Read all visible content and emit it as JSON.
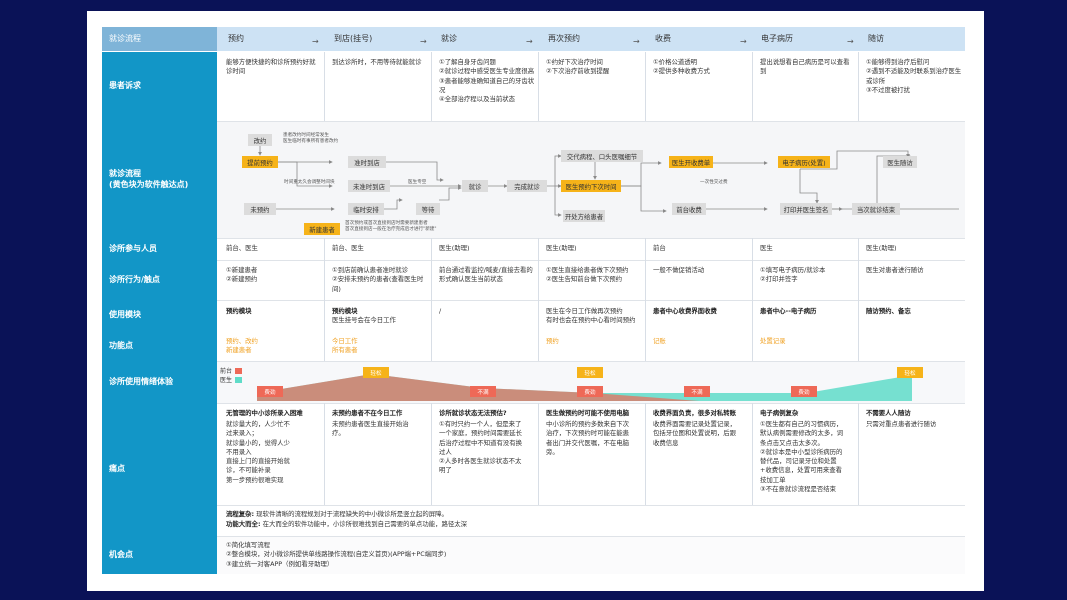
{
  "row_labels": {
    "header": "就诊流程",
    "appeal": "患者诉求",
    "flow": "就诊流程\n(黄色块为软件触达点)",
    "staff": "诊所参与人员",
    "behavior": "诊所行为/触点",
    "module": "使用模块",
    "function": "功能点",
    "emotion": "诊所使用情绪体验",
    "pain": "痛点",
    "opportunity": "机会点"
  },
  "stages": [
    "预约",
    "到店(挂号)",
    "就诊",
    "再次预约",
    "收费",
    "电子病历",
    "随访"
  ],
  "appeals": [
    "能够方便快捷的和诊所预约好就诊时间",
    "到达诊所时，不用等待就能就诊",
    "①了解自身牙齿问题\n②就诊过程中感受医生专业度很高\n③患者能够准确知道自己的牙齿状况\n④全部治疗程以及当前状态",
    "①约好下次治疗时间\n②下次治疗前收到提醒",
    "①价格公道透明\n②提供多种收费方式",
    "提出说想看自己病历是可以查看到",
    "①能够得到治疗后慰问\n②遇到不适能及时联系到治疗医生或诊所\n③不过度被打扰"
  ],
  "flow": {
    "nodes": {
      "reschedule": "改约",
      "book_ahead": "提前预约",
      "on_time": "准时到店",
      "not_on_time": "未准时到店",
      "not_booked": "未预约",
      "temp_arrange": "临时安排",
      "wait": "等待",
      "consult": "就诊",
      "done": "完成就诊",
      "handover": "交代病程、口头医嘱细节",
      "next_time": "医生预约下次时间",
      "prescribe": "开处方给患者",
      "bill": "医生开收费单",
      "front_charge": "前台收费",
      "emr": "电子病历(处置)",
      "print_sign": "打印并医生签名",
      "followup": "医生随访",
      "next_end": "当次就诊结束",
      "new_patient": "新建患者"
    },
    "notes": {
      "reschedule_note": "患者改约时间经常发生\n医生临时有事所有患者改约",
      "time_note": "时间重太久会调整时间块",
      "doctor_room": "医生专空",
      "new_patient_note": "首次预约或首次直接到店时需要新建患者\n首次直接到店一般在治疗完成后才进行\"新建\"",
      "once_charge": "一次性交过费"
    }
  },
  "staff": [
    "前台、医生",
    "前台、医生",
    "医生(助理)",
    "医生(助理)",
    "前台",
    "医生",
    "医生(助理)"
  ],
  "behavior": [
    "①新建患者\n②新建预约",
    "①到店前确认患者准时就诊\n②安排未预约的患者(查看医生时间)",
    "前台通过看监控/喊麦/直接去看的形式确认医生当前状态",
    "①医生直接给患者做下次预约\n②医生告知前台做下次预约",
    "一般不做促销活动",
    "①填写电子病历/就诊本\n②打印并签字",
    "医生对患者进行随访"
  ],
  "module": {
    "col1": "预约模块",
    "col2_title": "预约模块",
    "col2_sub": "医生挂号会在今日工作",
    "col3": "/",
    "col4": "医生在今日工作做再次预约\n有时也会在预约中心看时间预约",
    "col5": "患者中心收费界面收费",
    "col6": "患者中心--电子病历",
    "col7": "随访预约、备忘"
  },
  "functions": [
    "预约、改约\n新建患者",
    "今日工作\n所有患者",
    "",
    "预约",
    "记账",
    "处置记录",
    ""
  ],
  "emotion": {
    "legend_front": "前台",
    "legend_doctor": "医生",
    "front_color": "#ee6957",
    "doctor_color": "#5fdcc8",
    "tags": [
      {
        "label": "费劲",
        "kind": "r"
      },
      {
        "label": "轻松",
        "kind": "y"
      },
      {
        "label": "不满",
        "kind": "r"
      },
      {
        "label": "轻松",
        "kind": "y"
      },
      {
        "label": "费劲",
        "kind": "r"
      },
      {
        "label": "不满",
        "kind": "r"
      },
      {
        "label": "费劲",
        "kind": "r"
      },
      {
        "label": "轻松",
        "kind": "y"
      }
    ]
  },
  "pain": [
    {
      "title": "无管理的中小诊所录入困难",
      "body": "就诊量大的，人少忙不过来录入；\n就诊量小的，觉得人少不用录入\n直接上门的直接开始就诊，不可能补录\n第一步预约很难实现"
    },
    {
      "title": "未预约患者不在今日工作",
      "body": "未预约患者医生直接开始治疗。"
    },
    {
      "title": "诊所就诊状态无法预估?",
      "body": "①有时只约一个人，但是来了一个家庭，预约时间需要延长后治疗过程中不知道有没有换过人\n②人多时各医生就诊状态不太明了"
    },
    {
      "title": "医生做预约时可能不使用电脑",
      "body": "中小诊所的预约多数来自下次治疗，下次预约时可能在能患者出门并交代医嘱，不在电脑旁。"
    },
    {
      "title": "收费界面负责，很多对私转账",
      "body": "收费界面需要记录处置记录，包括牙位图和处置说明，后跟收费信息"
    },
    {
      "title": "电子病例复杂",
      "body": "①医生都有自己的习惯病历，默认病例需要修改的太多，词条点击又点击太多次。\n②就诊本是中小型诊所病历的替代品，司记录牙位和处置+收费信息，处置可用来查看技加工单\n③不在意就诊流程是否结束"
    },
    {
      "title": "不需要人人随访",
      "body": "只需对重点患者进行随访"
    }
  ],
  "summary": {
    "line1_bold": "流程复杂:",
    "line1": "现软件清晰的流程规划对于流程缺失的中小微诊所是竖立起的屏障。",
    "line2_bold": "功能大而全:",
    "line2": "在大而全的软件功能中，小诊所很难找到自己需要的单点功能，路径太深"
  },
  "opportunity": "①简化填写流程\n②整合模块，对小微诊所提供单线路操作流程(自定义首页)(APP端+PC端同步)\n③建立统一对客APP（例如看牙助理）"
}
